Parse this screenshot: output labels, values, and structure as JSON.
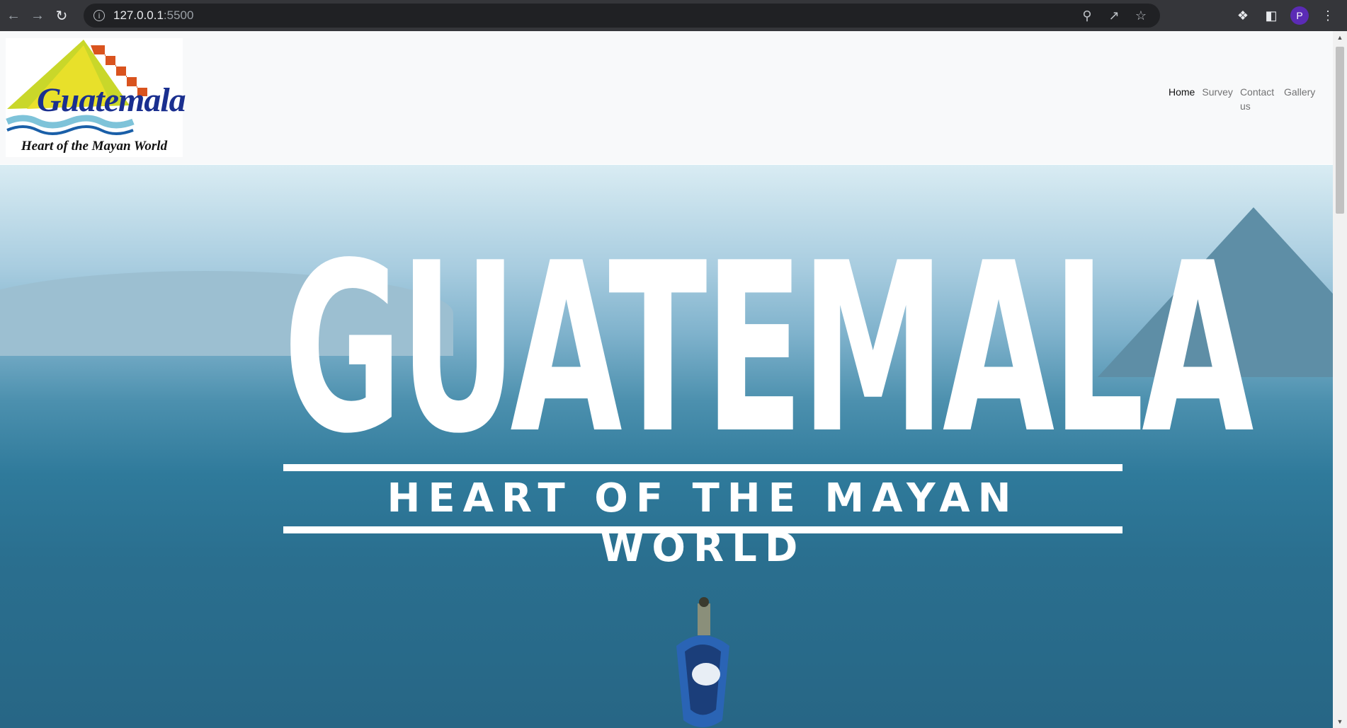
{
  "browser": {
    "url_host": "127.0.0.1",
    "url_port": ":5500",
    "profile_initial": "P",
    "icons": {
      "back": "arrow-left-icon",
      "forward": "arrow-right-icon",
      "reload": "reload-icon",
      "site_info": "info-icon",
      "zoom": "zoom-out-icon",
      "share": "share-icon",
      "bookmark": "star-icon",
      "extensions": "puzzle-icon",
      "side_panel": "side-panel-icon",
      "menu": "kebab-menu-icon"
    }
  },
  "navbar": {
    "logo": {
      "word": "Guatemala",
      "caption": "Heart of the Mayan World"
    },
    "links": [
      {
        "label": "Home",
        "active": true
      },
      {
        "label": "Survey",
        "active": false
      },
      {
        "label": "Contact us",
        "active": false
      },
      {
        "label": "Gallery",
        "active": false
      }
    ]
  },
  "hero": {
    "title": "GUATEMALA",
    "subtitle": "HEART OF THE MAYAN WORLD"
  },
  "colors": {
    "chrome_bg": "#35363a",
    "omnibox_bg": "#202124",
    "navbar_bg": "#f8f9fa",
    "avatar_bg": "#5b2bb5",
    "sea": "#2f7a9b"
  }
}
